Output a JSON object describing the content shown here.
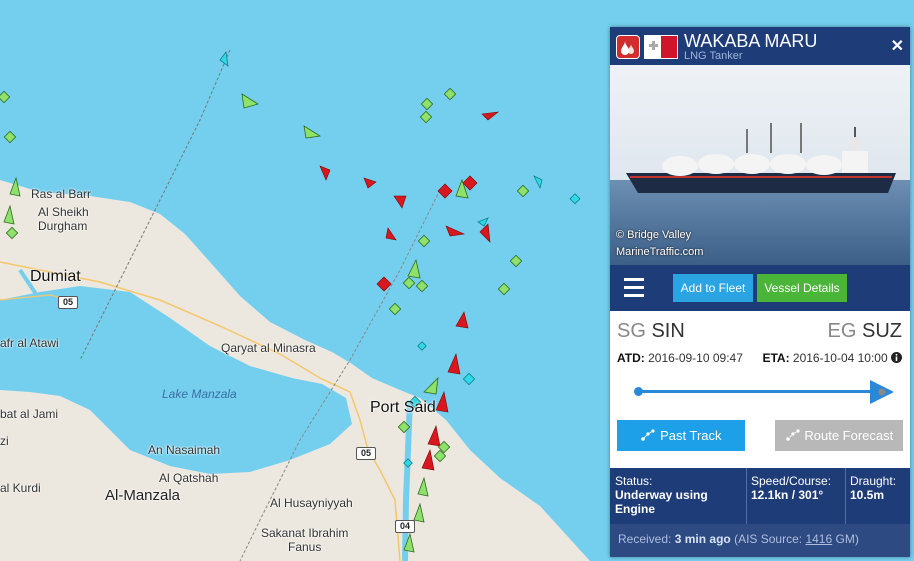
{
  "map": {
    "places": {
      "ras_al_barr": "Ras al Barr",
      "al_sheikh": "Al Sheikh",
      "durgham": "Durgham",
      "dumiat": "Dumiat",
      "afr_al_atawi": "afr al Atawi",
      "qaryat": "Qaryat al Minasra",
      "lake_manzala": "Lake Manzala",
      "port_said": "Port Said",
      "bat_al_jami": "bat al Jami",
      "zi": "zi",
      "an_nasaimah": "An Nasaimah",
      "al_qatshah": "Al Qatshah",
      "al_kurdi": "al Kurdi",
      "al_manzala": "Al-Manzala",
      "al_husayniyyah": "Al Husayniyyah",
      "sakanat1": "Sakanat Ibrahim",
      "sakanat2": "Fanus"
    },
    "roads": {
      "r05a": "05",
      "r05b": "05",
      "r04": "04"
    },
    "colors": {
      "sea": "#74cfee",
      "land": "#ece8df",
      "tanker": "#d8181e",
      "cargo": "#8ee26b",
      "passenger": "#2ed9e8"
    }
  },
  "vessel": {
    "name": "WAKABA MARU",
    "type": "LNG Tanker",
    "flag_icon": "malta-flag-icon",
    "photo_credit_1": "© Bridge Valley",
    "photo_credit_2": "MarineTraffic.com",
    "add_to_fleet": "Add to Fleet",
    "vessel_details": "Vessel Details",
    "from_code": "SG",
    "from_port": "SIN",
    "to_code": "EG",
    "to_port": "SUZ",
    "atd_label": "ATD:",
    "atd_value": "2016-09-10 09:47",
    "eta_label": "ETA:",
    "eta_value": "2016-10-04 10:00",
    "past_track": "Past Track",
    "route_forecast": "Route Forecast",
    "status_label": "Status:",
    "status_value": "Underway using Engine",
    "speed_label": "Speed/Course:",
    "speed_value": "12.1kn / 301°",
    "draught_label": "Draught:",
    "draught_value": "10.5m",
    "received_label": "Received:",
    "received_value": "3 min ago",
    "ais_prefix": "(AIS Source:",
    "ais_source": "1416",
    "ais_suffix": "GM)"
  }
}
